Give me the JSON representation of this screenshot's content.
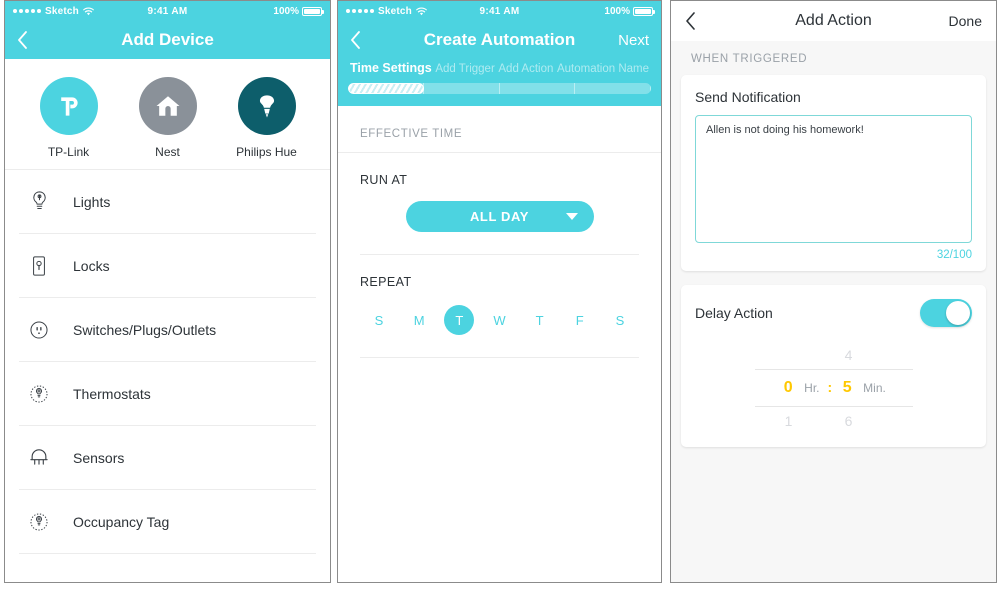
{
  "statusbar": {
    "carrier": "Sketch",
    "time": "9:41 AM",
    "battery": "100%",
    "wifi_icon": "wifi-icon",
    "battery_icon": "battery-full-icon"
  },
  "panel1": {
    "nav": {
      "back_icon": "chevron-left-icon",
      "title": "Add Device"
    },
    "brands": [
      {
        "label": "TP-Link",
        "icon": "tplink-logo-icon",
        "circle_color": "#4cd3e0"
      },
      {
        "label": "Nest",
        "icon": "house-icon",
        "circle_color": "#8a9199"
      },
      {
        "label": "Philips Hue",
        "icon": "lightbulb-icon",
        "circle_color": "#0d5e6b"
      }
    ],
    "devices": [
      {
        "label": "Lights",
        "icon": "bulb-outline-icon"
      },
      {
        "label": "Locks",
        "icon": "lock-outline-icon"
      },
      {
        "label": "Switches/Plugs/Outlets",
        "icon": "outlet-outline-icon"
      },
      {
        "label": "Thermostats",
        "icon": "thermostat-outline-icon"
      },
      {
        "label": "Sensors",
        "icon": "sensor-outline-icon"
      },
      {
        "label": "Occupancy Tag",
        "icon": "occupancy-tag-outline-icon"
      }
    ]
  },
  "panel2": {
    "nav": {
      "back_icon": "chevron-left-icon",
      "title": "Create Automation",
      "next_label": "Next"
    },
    "steps": [
      {
        "label": "Time Settings",
        "active": true
      },
      {
        "label": "Add Trigger",
        "active": false
      },
      {
        "label": "Add Action",
        "active": false
      },
      {
        "label": "Automation Name",
        "active": false
      }
    ],
    "progress_percent": 25,
    "section_title": "EFFECTIVE TIME",
    "run_at_label": "RUN AT",
    "run_at_value": "ALL DAY",
    "run_at_caret_icon": "caret-down-icon",
    "repeat_label": "REPEAT",
    "days": [
      {
        "label": "S",
        "selected": false
      },
      {
        "label": "M",
        "selected": false
      },
      {
        "label": "T",
        "selected": true
      },
      {
        "label": "W",
        "selected": false
      },
      {
        "label": "T",
        "selected": false
      },
      {
        "label": "F",
        "selected": false
      },
      {
        "label": "S",
        "selected": false
      }
    ]
  },
  "panel3": {
    "nav": {
      "back_icon": "chevron-left-icon",
      "title": "Add Action",
      "done_label": "Done"
    },
    "section_title": "WHEN TRIGGERED",
    "notification": {
      "title": "Send Notification",
      "message": "Allen is not doing his homework!",
      "counter": "32/100"
    },
    "delay": {
      "title": "Delay Action",
      "toggle_on": true,
      "toggle_icon": "toggle-switch-icon",
      "hours": "0",
      "hours_unit": "Hr.",
      "separator": ":",
      "minutes": "5",
      "minutes_unit": "Min.",
      "ghost_above_hours": "",
      "ghost_above_minutes": "4",
      "ghost_below_hours": "1",
      "ghost_below_minutes": "6"
    }
  },
  "colors": {
    "accent": "#4cd3e0",
    "yellow": "#ffc800",
    "teal_dark": "#0d5e6b",
    "gray": "#8a9199",
    "text": "#2d3338",
    "muted": "#9aa1a8"
  }
}
